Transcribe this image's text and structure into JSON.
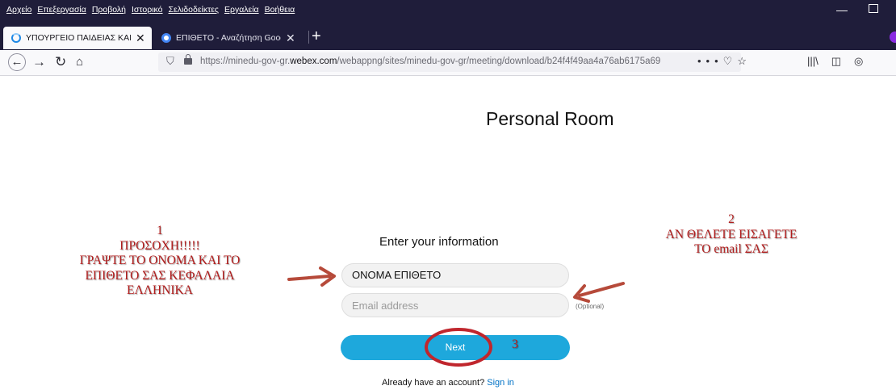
{
  "menubar": {
    "items": [
      "Αρχείο",
      "Επεξεργασία",
      "Προβολή",
      "Ιστορικό",
      "Σελιδοδείκτες",
      "Εργαλεία",
      "Βοήθεια"
    ]
  },
  "tabs": [
    {
      "title": "ΥΠΟΥΡΓΕΙΟ ΠΑΙΔΕΙΑΣ ΚΑΙ ΘΡΗΣΚ",
      "favicon_color": "#1e88e5"
    },
    {
      "title": "ΕΠΙΘΕΤΟ - Αναζήτηση Google",
      "favicon_color": "#4285f4"
    }
  ],
  "url": {
    "prefix": "https://minedu-gov-gr.",
    "domain": "webex.com",
    "path": "/webappng/sites/minedu-gov-gr/meeting/download/b24f4f49aa4a76ab6175a69"
  },
  "page": {
    "room_title": "Personal Room",
    "enter_info": "Enter your information",
    "name_value": "ΟΝΟΜΑ ΕΠΙΘΕΤΟ",
    "email_placeholder": "Email address",
    "optional": "(Optional)",
    "next_label": "Next",
    "signin_prompt": "Already have an account? ",
    "signin_link": "Sign in"
  },
  "annotations": {
    "note1": [
      "1",
      "ΠΡΟΣΟΧΗ!!!!!",
      "ΓΡΑΨΤΕ ΤΟ ΟΝΟΜΑ ΚΑΙ ΤΟ",
      "ΕΠΙΘΕΤΟ ΣΑΣ ΚΕΦΑΛΑΙΑ",
      "ΕΛΛΗΝΙΚΑ"
    ],
    "note2": [
      "2",
      "ΑΝ ΘΕΛΕΤΕ ΕΙΣΑΓΕΤΕ",
      "ΤΟ email ΣΑΣ"
    ],
    "note3": "3",
    "color": "#b11d1d"
  },
  "colors": {
    "chrome_dark": "#1f1d3a",
    "next_button": "#1ea8dc",
    "link": "#0072c6"
  }
}
